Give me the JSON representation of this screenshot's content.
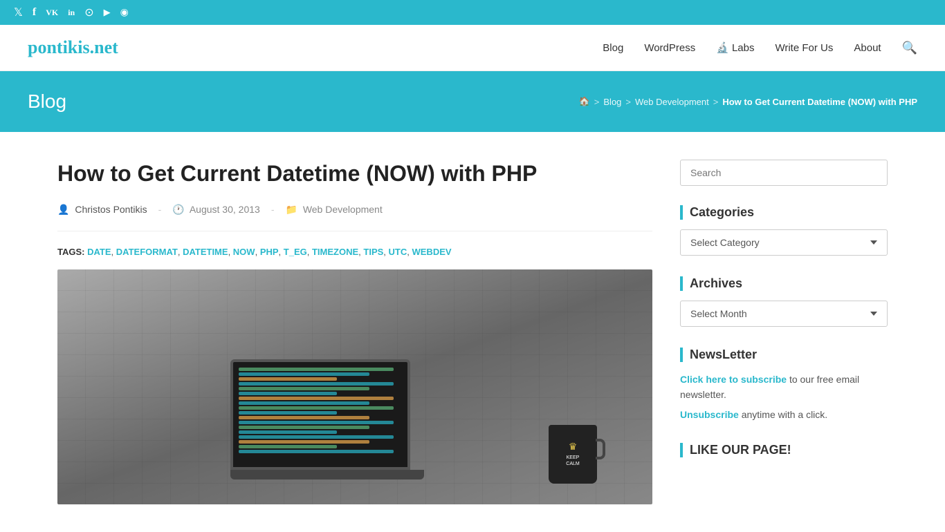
{
  "social_bar": {
    "icons": [
      {
        "name": "twitter-icon",
        "label": "Twitter",
        "symbol": "𝕏"
      },
      {
        "name": "facebook-icon",
        "label": "Facebook",
        "symbol": "f"
      },
      {
        "name": "vk-icon",
        "label": "VK",
        "symbol": "VK"
      },
      {
        "name": "linkedin-icon",
        "label": "LinkedIn",
        "symbol": "in"
      },
      {
        "name": "github-icon",
        "label": "GitHub",
        "symbol": "⊙"
      },
      {
        "name": "youtube-icon",
        "label": "YouTube",
        "symbol": "▶"
      },
      {
        "name": "rss-icon",
        "label": "RSS",
        "symbol": "◉"
      }
    ]
  },
  "header": {
    "logo": "pontikis.net",
    "nav": [
      {
        "label": "Blog",
        "href": "#"
      },
      {
        "label": "WordPress",
        "href": "#"
      },
      {
        "label": "Labs",
        "href": "#",
        "has_icon": true
      },
      {
        "label": "Write For Us",
        "href": "#"
      },
      {
        "label": "About",
        "href": "#"
      }
    ]
  },
  "page_header": {
    "title": "Blog",
    "breadcrumb": [
      {
        "label": "🏠",
        "href": "#"
      },
      {
        "sep": ">"
      },
      {
        "label": "Blog",
        "href": "#"
      },
      {
        "sep": ">"
      },
      {
        "label": "Web Development",
        "href": "#"
      },
      {
        "sep": ">"
      },
      {
        "label": "How to Get Current Datetime (NOW) with PHP",
        "current": true
      }
    ]
  },
  "article": {
    "title": "How to Get Current Datetime (NOW) with PHP",
    "author": "Christos Pontikis",
    "date": "August 30, 2013",
    "category": "Web Development",
    "tags_label": "TAGS:",
    "tags": [
      "DATE",
      "DATEFORMAT",
      "DATETIME",
      "NOW",
      "PHP",
      "T_EG",
      "TIMEZONE",
      "TIPS",
      "UTC",
      "WEBDEV"
    ]
  },
  "sidebar": {
    "search": {
      "placeholder": "Search"
    },
    "categories": {
      "heading": "Categories",
      "select_label": "Select Category",
      "options": [
        "Select Category"
      ]
    },
    "archives": {
      "heading": "Archives",
      "select_label": "Select Month",
      "options": [
        "Select Month"
      ]
    },
    "newsletter": {
      "heading": "NewsLetter",
      "subscribe_text": "Click here to subscribe",
      "subscribe_suffix": " to our free email newsletter.",
      "unsubscribe_text": "Unsubscribe",
      "unsubscribe_suffix": " anytime with a click."
    },
    "like_page": {
      "heading": "LIKE OUR PAGE!"
    }
  }
}
